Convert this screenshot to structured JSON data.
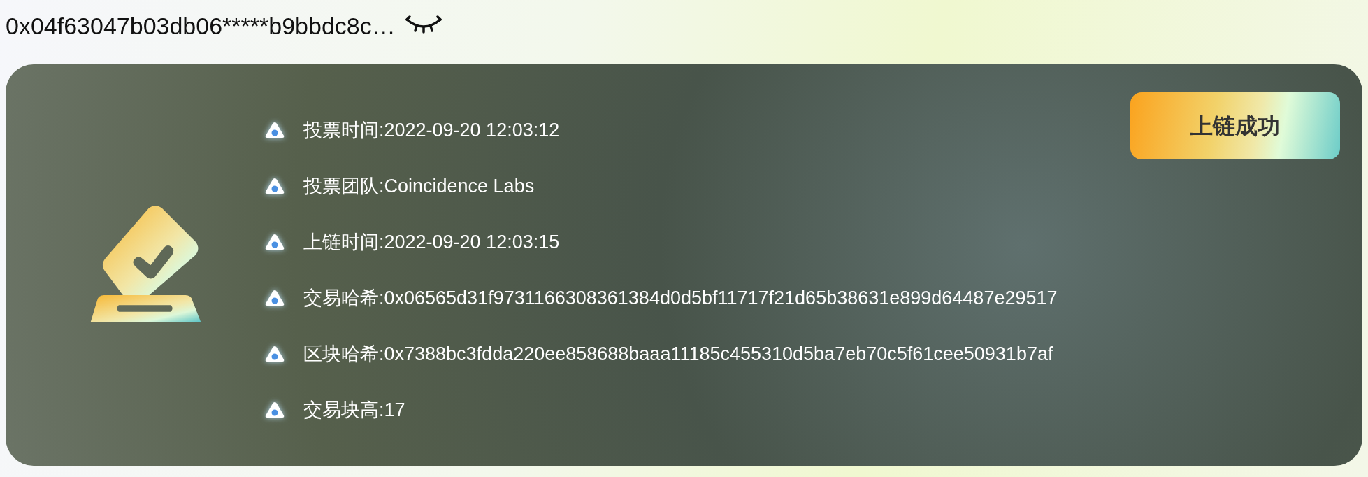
{
  "address": {
    "text": "0x04f63047b03db06*****b9bbdc8c…",
    "visible": false
  },
  "record": {
    "status": "上链成功",
    "fields": [
      {
        "text": "投票时间:2022-09-20 12:03:12"
      },
      {
        "text": "投票团队:Coincidence Labs"
      },
      {
        "text": "上链时间:2022-09-20 12:03:15"
      },
      {
        "text": "交易哈希:0x06565d31f9731166308361384d0d5bf11717f21d65b38631e899d64487e29517"
      },
      {
        "text": "区块哈希:0x7388bc3fdda220ee858688baaa11185c455310d5ba7eb70c5f61cee50931b7af"
      },
      {
        "text": "交易块高:17"
      }
    ]
  }
}
